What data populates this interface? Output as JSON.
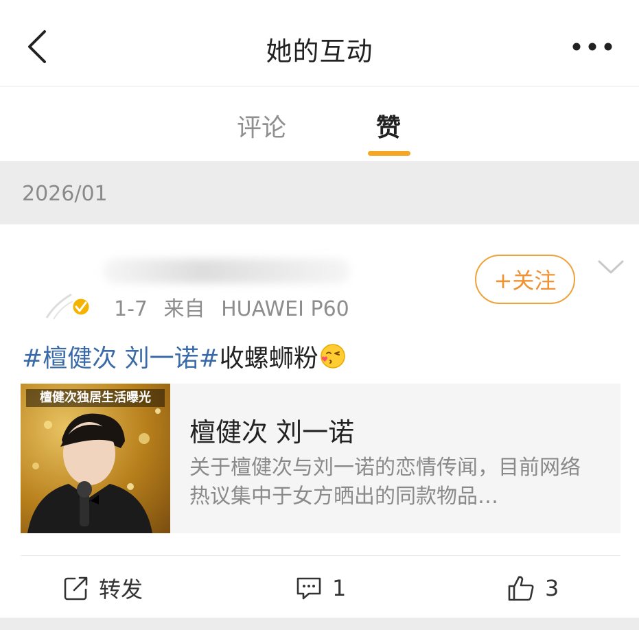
{
  "header": {
    "title": "她的互动",
    "back_icon": "chevron-left-icon",
    "more_icon": "more-dots-icon"
  },
  "tabs": [
    {
      "label": "评论",
      "active": false
    },
    {
      "label": "赞",
      "active": true
    }
  ],
  "accent_color": "#f5a623",
  "section": {
    "date": "2026/01"
  },
  "post": {
    "meta": {
      "date": "1-7",
      "source_prefix": "来自",
      "device": "HUAWEI P60"
    },
    "follow_label": "+关注",
    "text": {
      "hashtag": "#檀健次 刘一诺#",
      "body": "收螺蛳粉",
      "emoji": "kiss-face-emoji"
    },
    "link_card": {
      "thumb_caption": "檀健次独居生活曝光",
      "title": "檀健次 刘一诺",
      "description": "关于檀健次与刘一诺的恋情传闻，目前网络热议集中于女方晒出的同款物品…"
    },
    "actions": {
      "repost_label": "转发",
      "comment_count": "1",
      "like_count": "3"
    }
  }
}
